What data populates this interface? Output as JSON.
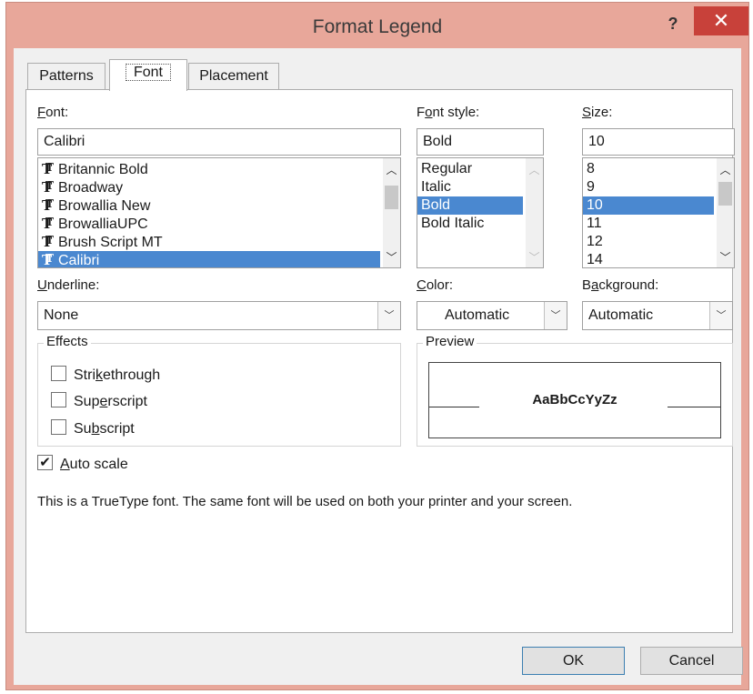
{
  "window": {
    "title": "Format Legend",
    "help": "?",
    "close": "✕"
  },
  "tabs": [
    {
      "label": "Patterns",
      "active": false
    },
    {
      "label": "Font",
      "active": true
    },
    {
      "label": "Placement",
      "active": false
    }
  ],
  "font": {
    "label_u": "F",
    "label_rest": "ont:",
    "value": "Calibri",
    "items": [
      "Britannic Bold",
      "Broadway",
      "Browallia New",
      "BrowalliaUPC",
      "Brush Script MT",
      "Calibri"
    ],
    "selected_index": 5
  },
  "font_style": {
    "label_pre": "F",
    "label_u": "o",
    "label_rest": "nt style:",
    "value": "Bold",
    "items": [
      "Regular",
      "Italic",
      "Bold",
      "Bold Italic"
    ],
    "selected_index": 2
  },
  "size": {
    "label_u": "S",
    "label_rest": "ize:",
    "value": "10",
    "items": [
      "8",
      "9",
      "10",
      "11",
      "12",
      "14"
    ],
    "selected_index": 2
  },
  "underline": {
    "label_u": "U",
    "label_rest": "nderline:",
    "value": "None"
  },
  "color": {
    "label_u": "C",
    "label_rest": "olor:",
    "value": "Automatic"
  },
  "background": {
    "label_pre": "B",
    "label_u": "a",
    "label_rest": "ckground:",
    "value": "Automatic"
  },
  "effects": {
    "title": "Effects",
    "items": [
      {
        "pre": "Stri",
        "u": "k",
        "rest": "ethrough",
        "checked": false
      },
      {
        "pre": "Sup",
        "u": "e",
        "rest": "rscript",
        "checked": false
      },
      {
        "pre": "Su",
        "u": "b",
        "rest": "script",
        "checked": false
      }
    ]
  },
  "preview": {
    "title": "Preview",
    "sample": "AaBbCcYyZz"
  },
  "auto_scale": {
    "pre": "",
    "u": "A",
    "rest": "uto scale",
    "checked": true
  },
  "info": "This is a TrueType font.  The same font will be used on both your printer and your screen.",
  "buttons": {
    "ok": "OK",
    "cancel": "Cancel"
  },
  "colors": {
    "titlebar": "#e8a79a",
    "close": "#c8413a",
    "selection": "#4a88d0"
  }
}
